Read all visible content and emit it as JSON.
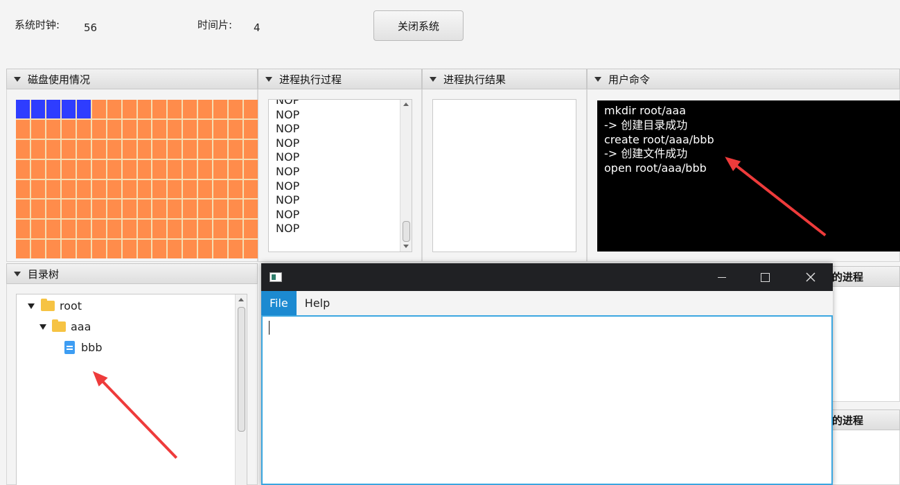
{
  "top": {
    "clock_label": "系统时钟:",
    "clock_value": "56",
    "slice_label": "时间片:",
    "slice_value": "4",
    "shutdown_button": "关闭系统"
  },
  "panels": {
    "disk": {
      "title": "磁盘使用情况",
      "used_blocks": 5,
      "total_blocks": 128,
      "used_color": "#2e3dff",
      "free_color": "#ff8c4b"
    },
    "process_exec": {
      "title": "进程执行过程",
      "items": [
        "NOP",
        "NOP",
        "NOP",
        "NOP",
        "NOP",
        "NOP",
        "NOP",
        "NOP",
        "NOP",
        "NOP"
      ]
    },
    "process_result": {
      "title": "进程执行结果"
    },
    "user_cmd": {
      "title": "用户命令",
      "lines": [
        "mkdir root/aaa",
        "-> 创建目录成功",
        "create root/aaa/bbb",
        "-> 创建文件成功",
        "open root/aaa/bbb"
      ]
    },
    "dir_tree": {
      "title": "目录树",
      "nodes": [
        {
          "label": "root",
          "type": "folder"
        },
        {
          "label": "aaa",
          "type": "folder"
        },
        {
          "label": "bbb",
          "type": "file"
        }
      ]
    },
    "right_partial_1": {
      "title": "的进程"
    },
    "right_partial_2": {
      "title": "的进程"
    }
  },
  "editor_window": {
    "menu": [
      "File",
      "Help"
    ],
    "accent": "#1c8ad1"
  }
}
